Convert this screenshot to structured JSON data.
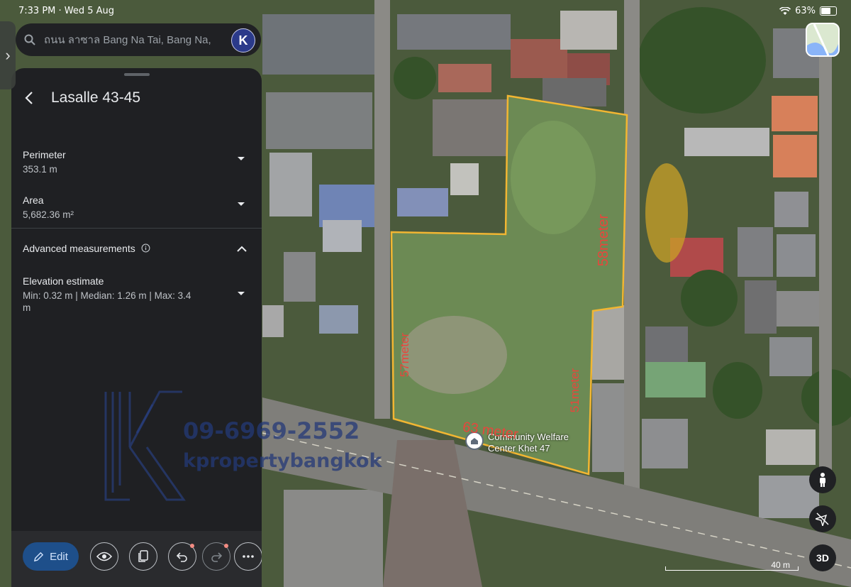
{
  "status_bar": {
    "time": "7:33 PM · Wed 5 Aug",
    "battery": "63%"
  },
  "search": {
    "text": "ถนน ลาซาล Bang Na Tai, Bang Na,",
    "avatar_letter": "K"
  },
  "panel": {
    "title": "Lasalle 43-45",
    "perimeter": {
      "label": "Perimeter",
      "value": "353.1 m"
    },
    "area": {
      "label": "Area",
      "value": "5,682.36 m²"
    },
    "advanced": {
      "label": "Advanced measurements"
    },
    "elevation": {
      "label": "Elevation estimate",
      "value": "Min: 0.32 m | Median: 1.26 m | Max: 3.4 m"
    },
    "toolbar": {
      "edit_label": "Edit"
    }
  },
  "map": {
    "place_label_line1": "Community Welfare",
    "place_label_line2": "Center Khet 47",
    "edge_labels": {
      "left": "57meter",
      "right_upper": "58meter",
      "right_lower": "51meter",
      "bottom": "63 meter"
    },
    "scale_label": "40 m",
    "mode_3d_label": "3D"
  },
  "watermark": {
    "phone": "09-6969-2552",
    "brand": "kpropertybangkok"
  },
  "colors": {
    "boundary": "#f2b632",
    "edge_label": "#e8463c",
    "panel_bg": "#1f2023",
    "edit_btn": "#1e4f8a"
  }
}
